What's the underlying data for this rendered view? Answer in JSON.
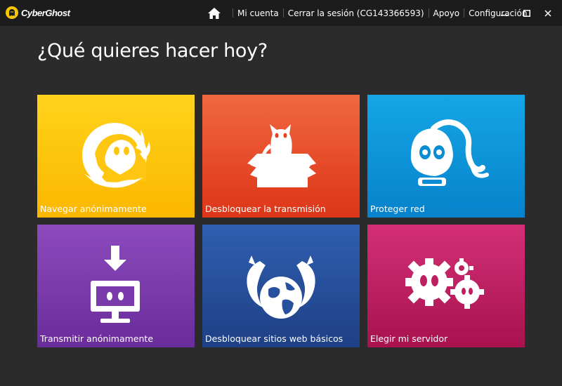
{
  "app": {
    "name": "CyberGhost"
  },
  "nav": {
    "account": "Mi cuenta",
    "logout": "Cerrar la sesión (CG143366593)",
    "support": "Apoyo",
    "settings": "Configuración"
  },
  "window_controls": {
    "minimize": "–",
    "maximize": "☐",
    "close": "✕"
  },
  "heading": "¿Qué quieres hacer hoy?",
  "tiles": [
    {
      "label": "Navegar anónimamente",
      "icon": "ghost-icon",
      "color": "#ffc20e"
    },
    {
      "label": "Desbloquear la transmisión",
      "icon": "cat-in-box-icon",
      "color": "#e84a27"
    },
    {
      "label": "Proteger red",
      "icon": "gas-mask-icon",
      "color": "#0c93d8"
    },
    {
      "label": "Transmitir anónimamente",
      "icon": "download-screen-icon",
      "color": "#7b3aab"
    },
    {
      "label": "Desbloquear sitios web básicos",
      "icon": "winged-globe-icon",
      "color": "#27509e"
    },
    {
      "label": "Elegir mi servidor",
      "icon": "gears-icon",
      "color": "#bd1f61"
    }
  ]
}
